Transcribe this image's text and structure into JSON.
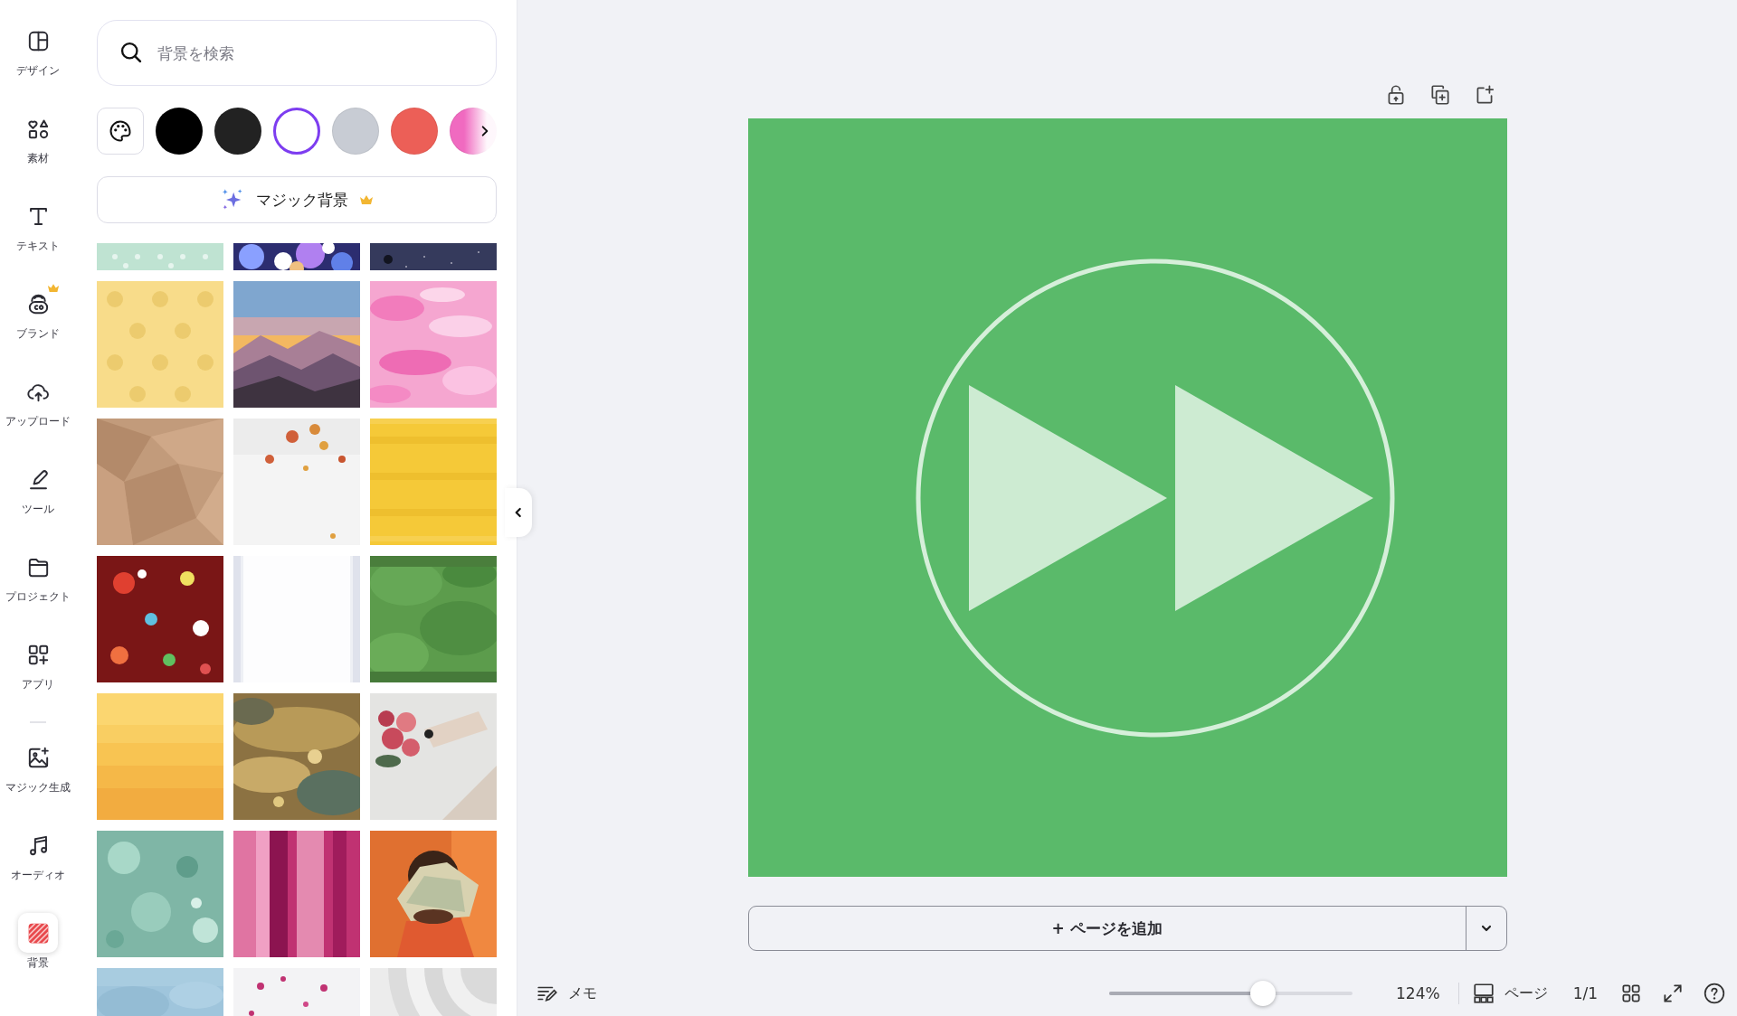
{
  "rail": {
    "items": [
      {
        "label": "デザイン",
        "selected": false,
        "premium": false
      },
      {
        "label": "素材",
        "selected": false,
        "premium": false
      },
      {
        "label": "テキスト",
        "selected": false,
        "premium": false
      },
      {
        "label": "ブランド",
        "selected": false,
        "premium": true
      },
      {
        "label": "アップロード",
        "selected": false,
        "premium": false
      },
      {
        "label": "ツール",
        "selected": false,
        "premium": false
      },
      {
        "label": "プロジェクト",
        "selected": false,
        "premium": false
      },
      {
        "label": "アプリ",
        "selected": false,
        "premium": false
      },
      {
        "label": "マジック生成",
        "selected": false,
        "premium": false
      },
      {
        "label": "オーディオ",
        "selected": false,
        "premium": false
      },
      {
        "label": "背景",
        "selected": true,
        "premium": false
      }
    ]
  },
  "search": {
    "placeholder": "背景を検索"
  },
  "swatches": [
    {
      "color": "#000000",
      "selected": false
    },
    {
      "color": "#222222",
      "selected": false
    },
    {
      "color": "#ffffff",
      "selected": true
    },
    {
      "color": "#c8ccd4",
      "selected": false
    },
    {
      "color": "#ec5f57",
      "selected": false
    },
    {
      "color": "#f06ac0",
      "selected": false
    }
  ],
  "magic_button": {
    "label": "マジック背景",
    "premium": true
  },
  "add_page": {
    "label": "+ ページを追加"
  },
  "footer": {
    "notes": "メモ",
    "zoom": {
      "level": 0.63,
      "reading": "124%"
    },
    "pages_label": "ページ",
    "page_count": "1/1"
  }
}
